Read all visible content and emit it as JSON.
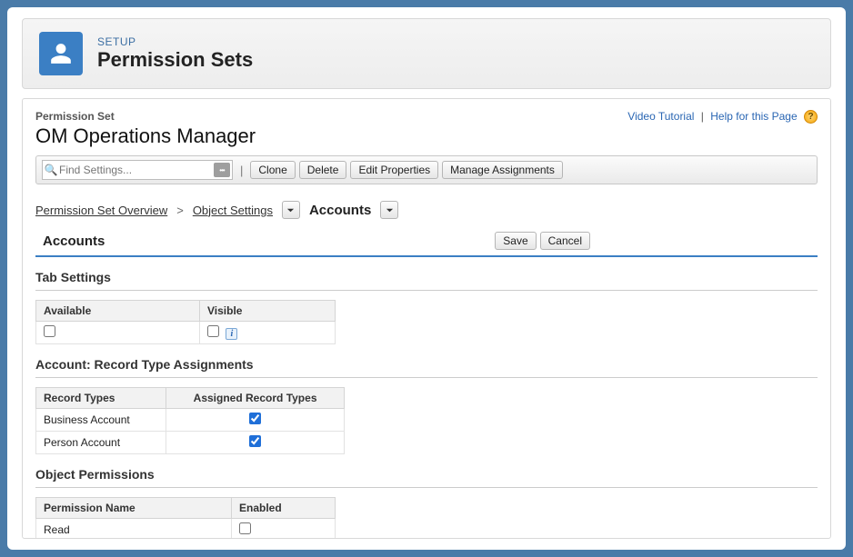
{
  "banner": {
    "setup_label": "SETUP",
    "title": "Permission Sets"
  },
  "top_links": {
    "video": "Video Tutorial",
    "help": "Help for this Page"
  },
  "header": {
    "label": "Permission Set",
    "name": "OM Operations Manager"
  },
  "search": {
    "placeholder": "Find Settings..."
  },
  "toolbar": {
    "clone": "Clone",
    "delete": "Delete",
    "edit_props": "Edit Properties",
    "manage": "Manage Assignments"
  },
  "breadcrumb": {
    "overview": "Permission Set Overview",
    "object_settings": "Object Settings",
    "current": "Accounts"
  },
  "actions": {
    "save": "Save",
    "cancel": "Cancel"
  },
  "object_name": "Accounts",
  "tab_settings": {
    "heading": "Tab Settings",
    "cols": {
      "available": "Available",
      "visible": "Visible"
    },
    "row": {
      "available_checked": false,
      "visible_checked": false
    }
  },
  "record_types": {
    "heading": "Account: Record Type Assignments",
    "cols": {
      "name": "Record Types",
      "assigned": "Assigned Record Types"
    },
    "rows": [
      {
        "name": "Business Account",
        "assigned": true
      },
      {
        "name": "Person Account",
        "assigned": true
      }
    ]
  },
  "object_perms": {
    "heading": "Object Permissions",
    "cols": {
      "name": "Permission Name",
      "enabled": "Enabled"
    },
    "rows": [
      {
        "name": "Read",
        "enabled": false
      }
    ]
  }
}
